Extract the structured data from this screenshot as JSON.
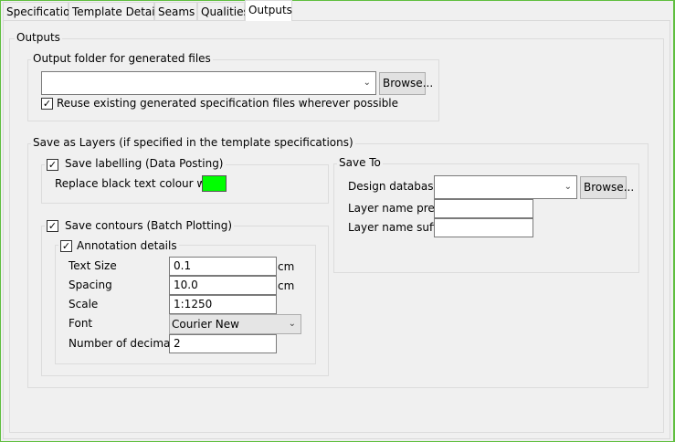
{
  "tabs": [
    {
      "label": "Specification",
      "selected": false
    },
    {
      "label": "Template Details",
      "selected": false
    },
    {
      "label": "Seams",
      "selected": false
    },
    {
      "label": "Qualities",
      "selected": false
    },
    {
      "label": "Outputs",
      "selected": true
    }
  ],
  "outputs": {
    "title": "Outputs",
    "output_folder": {
      "title": "Output folder for generated files",
      "value": "",
      "browse_label": "Browse...",
      "reuse_checked": true,
      "reuse_label": "Reuse existing generated specification files wherever possible"
    },
    "save_as_layers": {
      "title": "Save as Layers (if specified in the template specifications)",
      "save_labelling": {
        "checked": true,
        "label": "Save labelling (Data Posting)",
        "replace_label": "Replace black text colour with:",
        "replace_color": "#00ff00"
      },
      "save_contours": {
        "checked": true,
        "label": "Save contours (Batch Plotting)",
        "annotation": {
          "checked": true,
          "label": "Annotation details",
          "text_size": {
            "label": "Text Size",
            "value": "0.1",
            "unit": "cm"
          },
          "spacing": {
            "label": "Spacing",
            "value": "10.0",
            "unit": "cm"
          },
          "scale": {
            "label": "Scale",
            "value": "1:1250"
          },
          "font": {
            "label": "Font",
            "value": "Courier New"
          },
          "decimals": {
            "label": "Number of decimals",
            "value": "2"
          }
        }
      },
      "save_to": {
        "title": "Save To",
        "design_database_label": "Design database",
        "design_database_value": "",
        "browse_label": "Browse...",
        "prefix_label": "Layer name prefix",
        "prefix_value": "",
        "suffix_label": "Layer name suffix",
        "suffix_value": ""
      }
    }
  }
}
